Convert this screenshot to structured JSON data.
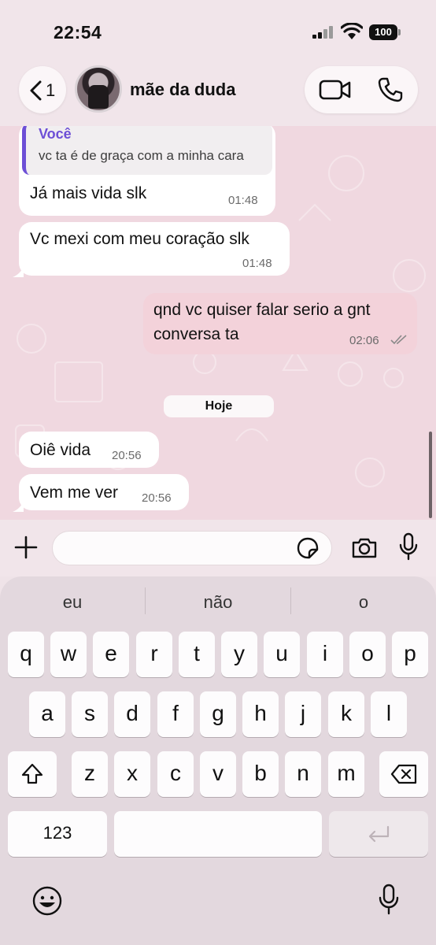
{
  "status_bar": {
    "time": "22:54",
    "battery": "100"
  },
  "header": {
    "back_count": "1",
    "contact_name": "mãe da duda"
  },
  "messages": {
    "m1": {
      "quote_author": "Você",
      "quote_text": "vc ta é de graça com a minha cara",
      "text": "Já mais vida slk",
      "time": "01:48"
    },
    "m2": {
      "text": "Vc mexi com meu coração slk",
      "time": "01:48"
    },
    "m3": {
      "line1": "qnd vc quiser falar serio a gnt",
      "line2": "conversa ta",
      "time": "02:06"
    },
    "date_separator": "Hoje",
    "m4": {
      "text": "Oiê vida",
      "time": "20:56"
    },
    "m5": {
      "text": "Vem me ver",
      "time": "20:56"
    }
  },
  "input": {
    "placeholder": ""
  },
  "keyboard": {
    "suggestions": [
      "eu",
      "não",
      "o"
    ],
    "row1": [
      "q",
      "w",
      "e",
      "r",
      "t",
      "y",
      "u",
      "i",
      "o",
      "p"
    ],
    "row2": [
      "a",
      "s",
      "d",
      "f",
      "g",
      "h",
      "j",
      "k",
      "l"
    ],
    "row3": [
      "z",
      "x",
      "c",
      "v",
      "b",
      "n",
      "m"
    ],
    "numbers_label": "123"
  },
  "colors": {
    "chat_background": "#f0d8e0",
    "incoming_bubble": "#ffffff",
    "outgoing_bubble": "#f3d2da",
    "quote_accent": "#6d4fd6",
    "read_ticks": "#8a8a8a"
  },
  "icons": [
    "chevron-left-icon",
    "video-call-icon",
    "phone-icon",
    "plus-icon",
    "sticker-icon",
    "camera-icon",
    "mic-icon",
    "shift-icon",
    "backspace-icon",
    "return-icon",
    "emoji-icon",
    "dictation-mic-icon",
    "double-check-icon"
  ]
}
